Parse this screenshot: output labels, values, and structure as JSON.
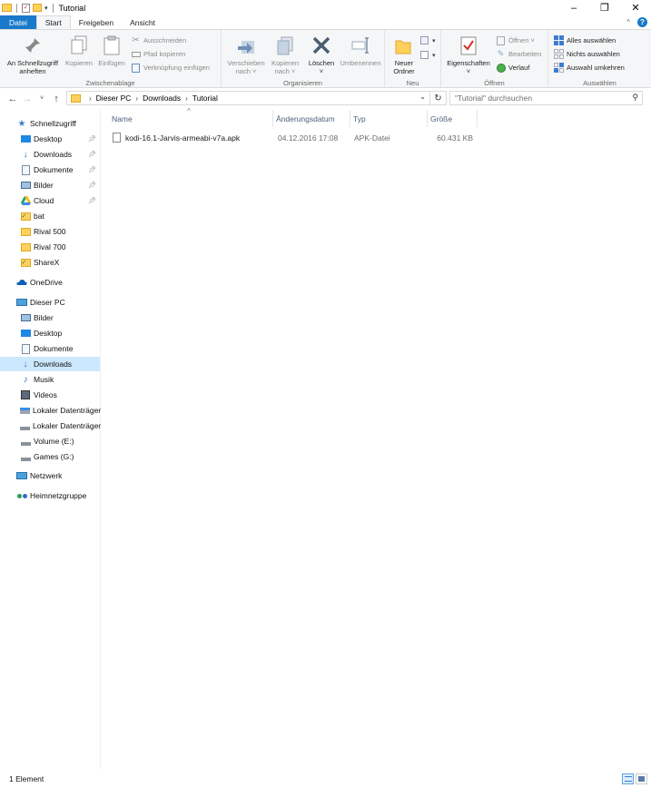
{
  "window": {
    "title": "Tutorial"
  },
  "tabs": [
    {
      "label": "Datei"
    },
    {
      "label": "Start"
    },
    {
      "label": "Freigeben"
    },
    {
      "label": "Ansicht"
    }
  ],
  "ribbon": {
    "clipboard": {
      "label": "Zwischenablage",
      "pin": "An Schnellzugriff\nanheften",
      "copy": "Kopieren",
      "paste": "Einfügen",
      "cut": "Ausschneiden",
      "copy_path": "Pfad kopieren",
      "paste_shortcut": "Verknüpfung einfügen"
    },
    "organize": {
      "label": "Organisieren",
      "move": "Verschieben\nnach ˅",
      "copy_to": "Kopieren\nnach ˅",
      "delete": "Löschen\n˅",
      "rename": "Umbenennen"
    },
    "new": {
      "label": "Neu",
      "new_folder": "Neuer\nOrdner"
    },
    "open": {
      "label": "Öffnen",
      "properties": "Eigenschaften\n˅",
      "open": "Öffnen ˅",
      "edit": "Bearbeiten",
      "history": "Verlauf"
    },
    "select": {
      "label": "Auswählen",
      "select_all": "Alles auswählen",
      "select_none": "Nichts auswählen",
      "invert": "Auswahl umkehren"
    }
  },
  "address": {
    "crumbs": [
      "Dieser PC",
      "Downloads",
      "Tutorial"
    ],
    "search_placeholder": "\"Tutorial\" durchsuchen"
  },
  "sidebar": {
    "quick_access": "Schnellzugriff",
    "quick_items": [
      "Desktop",
      "Downloads",
      "Dokumente",
      "Bilder",
      "Cloud",
      "bat",
      "Rival 500",
      "Rival 700",
      "ShareX"
    ],
    "onedrive": "OneDrive",
    "this_pc": "Dieser PC",
    "pc_items": [
      "Bilder",
      "Desktop",
      "Dokumente",
      "Downloads",
      "Musik",
      "Videos",
      "Lokaler Datenträger",
      "Lokaler Datenträger",
      "Volume (E:)",
      "Games (G:)"
    ],
    "network": "Netzwerk",
    "homegroup": "Heimnetzgruppe"
  },
  "columns": [
    "Name",
    "Änderungsdatum",
    "Typ",
    "Größe"
  ],
  "files": [
    {
      "name": "kodi-16.1-Jarvis-armeabi-v7a.apk",
      "date": "04.12.2016 17:08",
      "type": "APK-Datei",
      "size": "60.431 KB"
    }
  ],
  "status": {
    "count": "1 Element"
  },
  "colors": {
    "accent": "#1979ca",
    "selection": "#cce8ff",
    "folder": "#ffd15c"
  }
}
